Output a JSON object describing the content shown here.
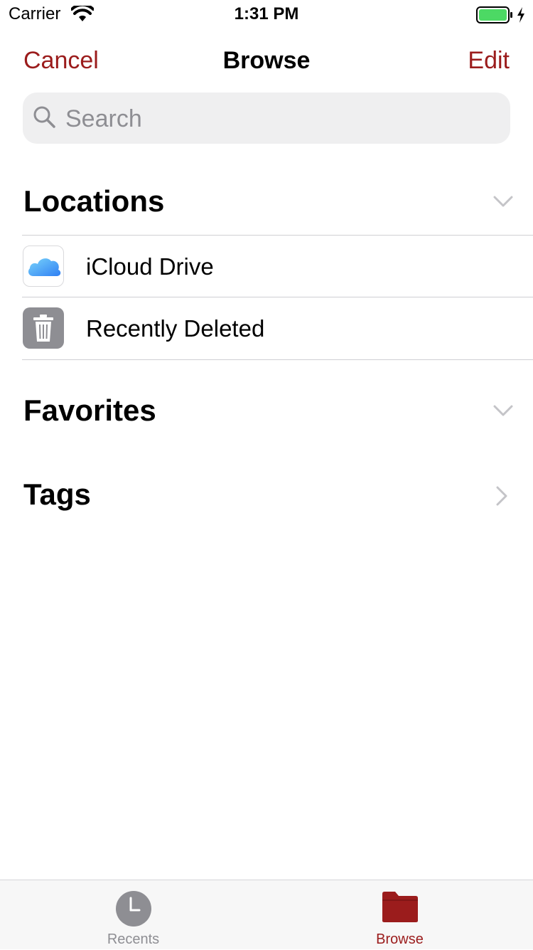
{
  "status_bar": {
    "carrier": "Carrier",
    "time": "1:31 PM",
    "icons": [
      "wifi-icon",
      "battery-icon",
      "charging-bolt-icon"
    ],
    "battery_color": "#4cd964"
  },
  "nav": {
    "cancel_label": "Cancel",
    "title": "Browse",
    "edit_label": "Edit",
    "accent_color": "#9b1c1c"
  },
  "search": {
    "placeholder": "Search",
    "value": ""
  },
  "sections": {
    "locations": {
      "title": "Locations",
      "icon": "chevron-down-icon",
      "items": [
        {
          "label": "iCloud Drive",
          "icon": "icloud-icon"
        },
        {
          "label": "Recently Deleted",
          "icon": "trash-icon"
        }
      ]
    },
    "favorites": {
      "title": "Favorites",
      "icon": "chevron-down-icon"
    },
    "tags": {
      "title": "Tags",
      "icon": "chevron-right-icon"
    }
  },
  "tabbar": {
    "tabs": [
      {
        "label": "Recents",
        "icon": "clock-icon",
        "selected": false
      },
      {
        "label": "Browse",
        "icon": "folder-icon",
        "selected": true
      }
    ]
  }
}
